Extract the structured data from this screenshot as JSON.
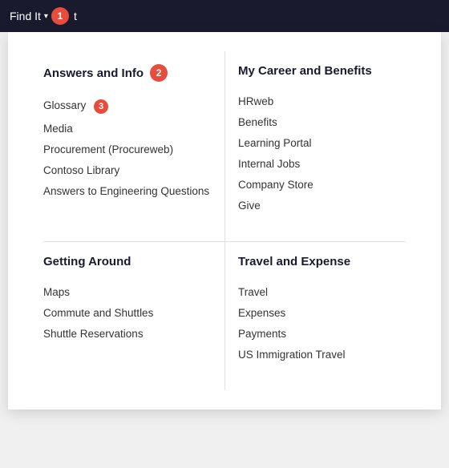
{
  "topbar": {
    "find_it_label": "Find It",
    "extra_text": "t",
    "badge1": "1"
  },
  "sections": [
    {
      "id": "answers-info",
      "title": "Answers and Info",
      "badge": "2",
      "items": [
        {
          "id": "glossary",
          "label": "Glossary",
          "badge": "3"
        },
        {
          "id": "media",
          "label": "Media"
        },
        {
          "id": "procurement",
          "label": "Procurement (Procureweb)"
        },
        {
          "id": "contoso-library",
          "label": "Contoso Library"
        },
        {
          "id": "answers-engineering",
          "label": "Answers to Engineering Questions"
        }
      ]
    },
    {
      "id": "career-benefits",
      "title": "My Career and Benefits",
      "items": [
        {
          "id": "hrweb",
          "label": "HRweb"
        },
        {
          "id": "benefits",
          "label": "Benefits"
        },
        {
          "id": "learning-portal",
          "label": "Learning Portal"
        },
        {
          "id": "internal-jobs",
          "label": "Internal Jobs"
        },
        {
          "id": "company-store",
          "label": "Company Store"
        },
        {
          "id": "give",
          "label": "Give"
        }
      ]
    },
    {
      "id": "getting-around",
      "title": "Getting Around",
      "items": [
        {
          "id": "maps",
          "label": "Maps"
        },
        {
          "id": "commute-shuttles",
          "label": "Commute and Shuttles"
        },
        {
          "id": "shuttle-reservations",
          "label": "Shuttle Reservations"
        }
      ]
    },
    {
      "id": "travel-expense",
      "title": "Travel and Expense",
      "items": [
        {
          "id": "travel",
          "label": "Travel"
        },
        {
          "id": "expenses",
          "label": "Expenses"
        },
        {
          "id": "payments",
          "label": "Payments"
        },
        {
          "id": "us-immigration",
          "label": "US Immigration Travel"
        }
      ]
    }
  ]
}
